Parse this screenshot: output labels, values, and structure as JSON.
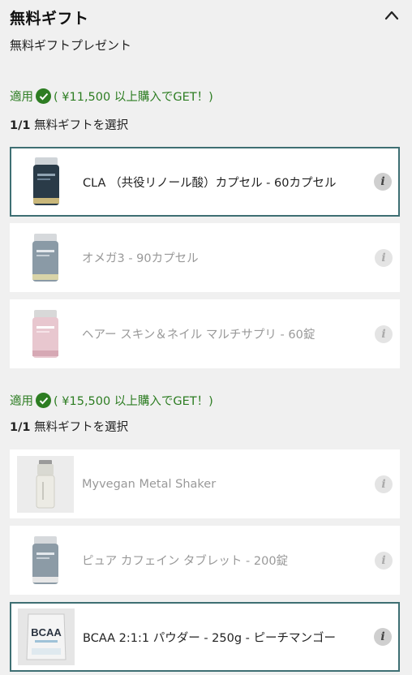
{
  "header": {
    "title": "無料ギフト",
    "subtitle": "無料ギフトプレゼント"
  },
  "tiers": [
    {
      "applied_label": "適用",
      "threshold_text": "( ¥11,500 以上購入でGET！)",
      "select_count": "1/1",
      "select_text": " 無料ギフトを選択",
      "items": [
        {
          "name": "CLA （共役リノール酸）カプセル - 60カプセル",
          "selected": true,
          "thumb": "capsule-bottle-dark"
        },
        {
          "name": "オメガ3 - 90カプセル",
          "selected": false,
          "thumb": "capsule-bottle-grey"
        },
        {
          "name": "ヘアー スキン＆ネイル マルチサプリ - 60錠",
          "selected": false,
          "thumb": "capsule-bottle-pink"
        }
      ]
    },
    {
      "applied_label": "適用",
      "threshold_text": "( ¥15,500 以上購入でGET！)",
      "select_count": "1/1",
      "select_text": " 無料ギフトを選択",
      "items": [
        {
          "name": "Myvegan Metal Shaker",
          "selected": false,
          "thumb": "shaker"
        },
        {
          "name": "ピュア カフェイン タブレット - 200錠",
          "selected": false,
          "thumb": "capsule-bottle-grey"
        },
        {
          "name": "BCAA 2:1:1 パウダー - 250g - ピーチマンゴー",
          "selected": true,
          "thumb": "powder-pouch",
          "pouch_text": "BCAA"
        }
      ]
    }
  ],
  "info_glyph": "i",
  "colors": {
    "applied_green": "#2d7d22",
    "selected_border": "#3e6f73",
    "background": "#f0f0f0"
  }
}
